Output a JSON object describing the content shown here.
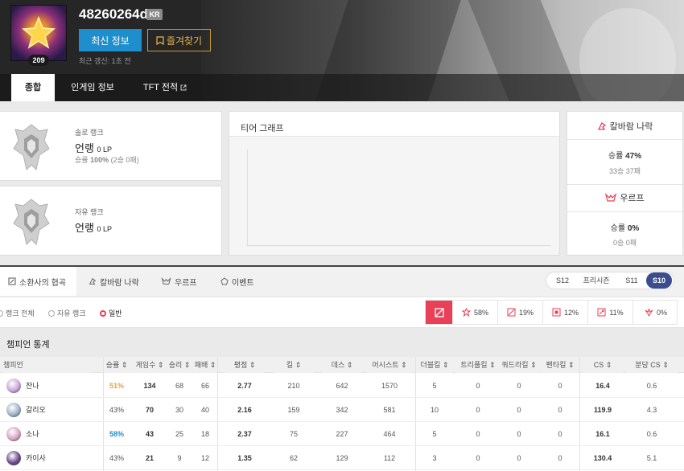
{
  "profile": {
    "name": "48260264del",
    "region": "KR",
    "level": "209",
    "refresh_label": "최신 정보",
    "favorite_label": "즐겨찾기",
    "updated": "최근 갱신: 1초 전"
  },
  "tabs": [
    {
      "label": "종합"
    },
    {
      "label": "인게임 정보"
    },
    {
      "label": "TFT 전적"
    }
  ],
  "ranks": {
    "solo": {
      "type": "솔로 랭크",
      "tier": "언랭",
      "lp": "0 LP",
      "wr_label": "승률",
      "wr": "100%",
      "record": "(2승 0패)"
    },
    "flex": {
      "type": "자유 랭크",
      "tier": "언랭",
      "lp": "0 LP"
    }
  },
  "tier_graph": {
    "title": "티어 그래프"
  },
  "side": {
    "aram": {
      "title": "칼바람 나락",
      "wr_label": "승률",
      "wr": "47%",
      "record": "33승 37패"
    },
    "urf": {
      "title": "우르프",
      "wr_label": "승률",
      "wr": "0%",
      "record": "0승 0패"
    }
  },
  "modes": [
    {
      "label": "소환사의 협곡"
    },
    {
      "label": "칼바람 나락"
    },
    {
      "label": "우르프"
    },
    {
      "label": "이벤트"
    }
  ],
  "seasons": [
    "S12",
    "프리시즌",
    "S11",
    "S10"
  ],
  "queue_filters": [
    "랭크 전체",
    "자유 랭크",
    "일반"
  ],
  "positions": [
    {
      "icon": "all-positions-icon",
      "pct": ""
    },
    {
      "icon": "top-icon",
      "pct": "58%"
    },
    {
      "icon": "jungle-icon",
      "pct": "19%"
    },
    {
      "icon": "mid-icon",
      "pct": "12%"
    },
    {
      "icon": "adc-icon",
      "pct": "11%"
    },
    {
      "icon": "support-icon",
      "pct": "0%"
    }
  ],
  "stats": {
    "title": "챔피언 통계",
    "headers": [
      "챔피언",
      "승률",
      "게임수",
      "승리",
      "패배",
      "평점",
      "킬",
      "데스",
      "어시스트",
      "더블킬",
      "트리플킬",
      "쿼드라킬",
      "펜타킬",
      "CS",
      "분당 CS"
    ],
    "rows": [
      {
        "name": "잔나",
        "wr": "51%",
        "games": "134",
        "wins": "68",
        "losses": "66",
        "kda": "2.77",
        "kills": "210",
        "deaths": "642",
        "assists": "1570",
        "double": "5",
        "triple": "0",
        "quadra": "0",
        "penta": "0",
        "cs": "16.4",
        "cspm": "0.6"
      },
      {
        "name": "갈리오",
        "wr": "43%",
        "games": "70",
        "wins": "30",
        "losses": "40",
        "kda": "2.16",
        "kills": "159",
        "deaths": "342",
        "assists": "581",
        "double": "10",
        "triple": "0",
        "quadra": "0",
        "penta": "0",
        "cs": "119.9",
        "cspm": "4.3"
      },
      {
        "name": "소나",
        "wr": "58%",
        "games": "43",
        "wins": "25",
        "losses": "18",
        "kda": "2.37",
        "kills": "75",
        "deaths": "227",
        "assists": "464",
        "double": "5",
        "triple": "0",
        "quadra": "0",
        "penta": "0",
        "cs": "16.1",
        "cspm": "0.6"
      },
      {
        "name": "카이사",
        "wr": "43%",
        "games": "21",
        "wins": "9",
        "losses": "12",
        "kda": "1.35",
        "kills": "62",
        "deaths": "129",
        "assists": "112",
        "double": "3",
        "triple": "0",
        "quadra": "0",
        "penta": "0",
        "cs": "130.4",
        "cspm": "5.1"
      }
    ]
  },
  "colors": {
    "accent": "#1f8ecd",
    "red": "#e84057",
    "gold": "#e9a53c",
    "season_active": "#3b4d8c"
  }
}
